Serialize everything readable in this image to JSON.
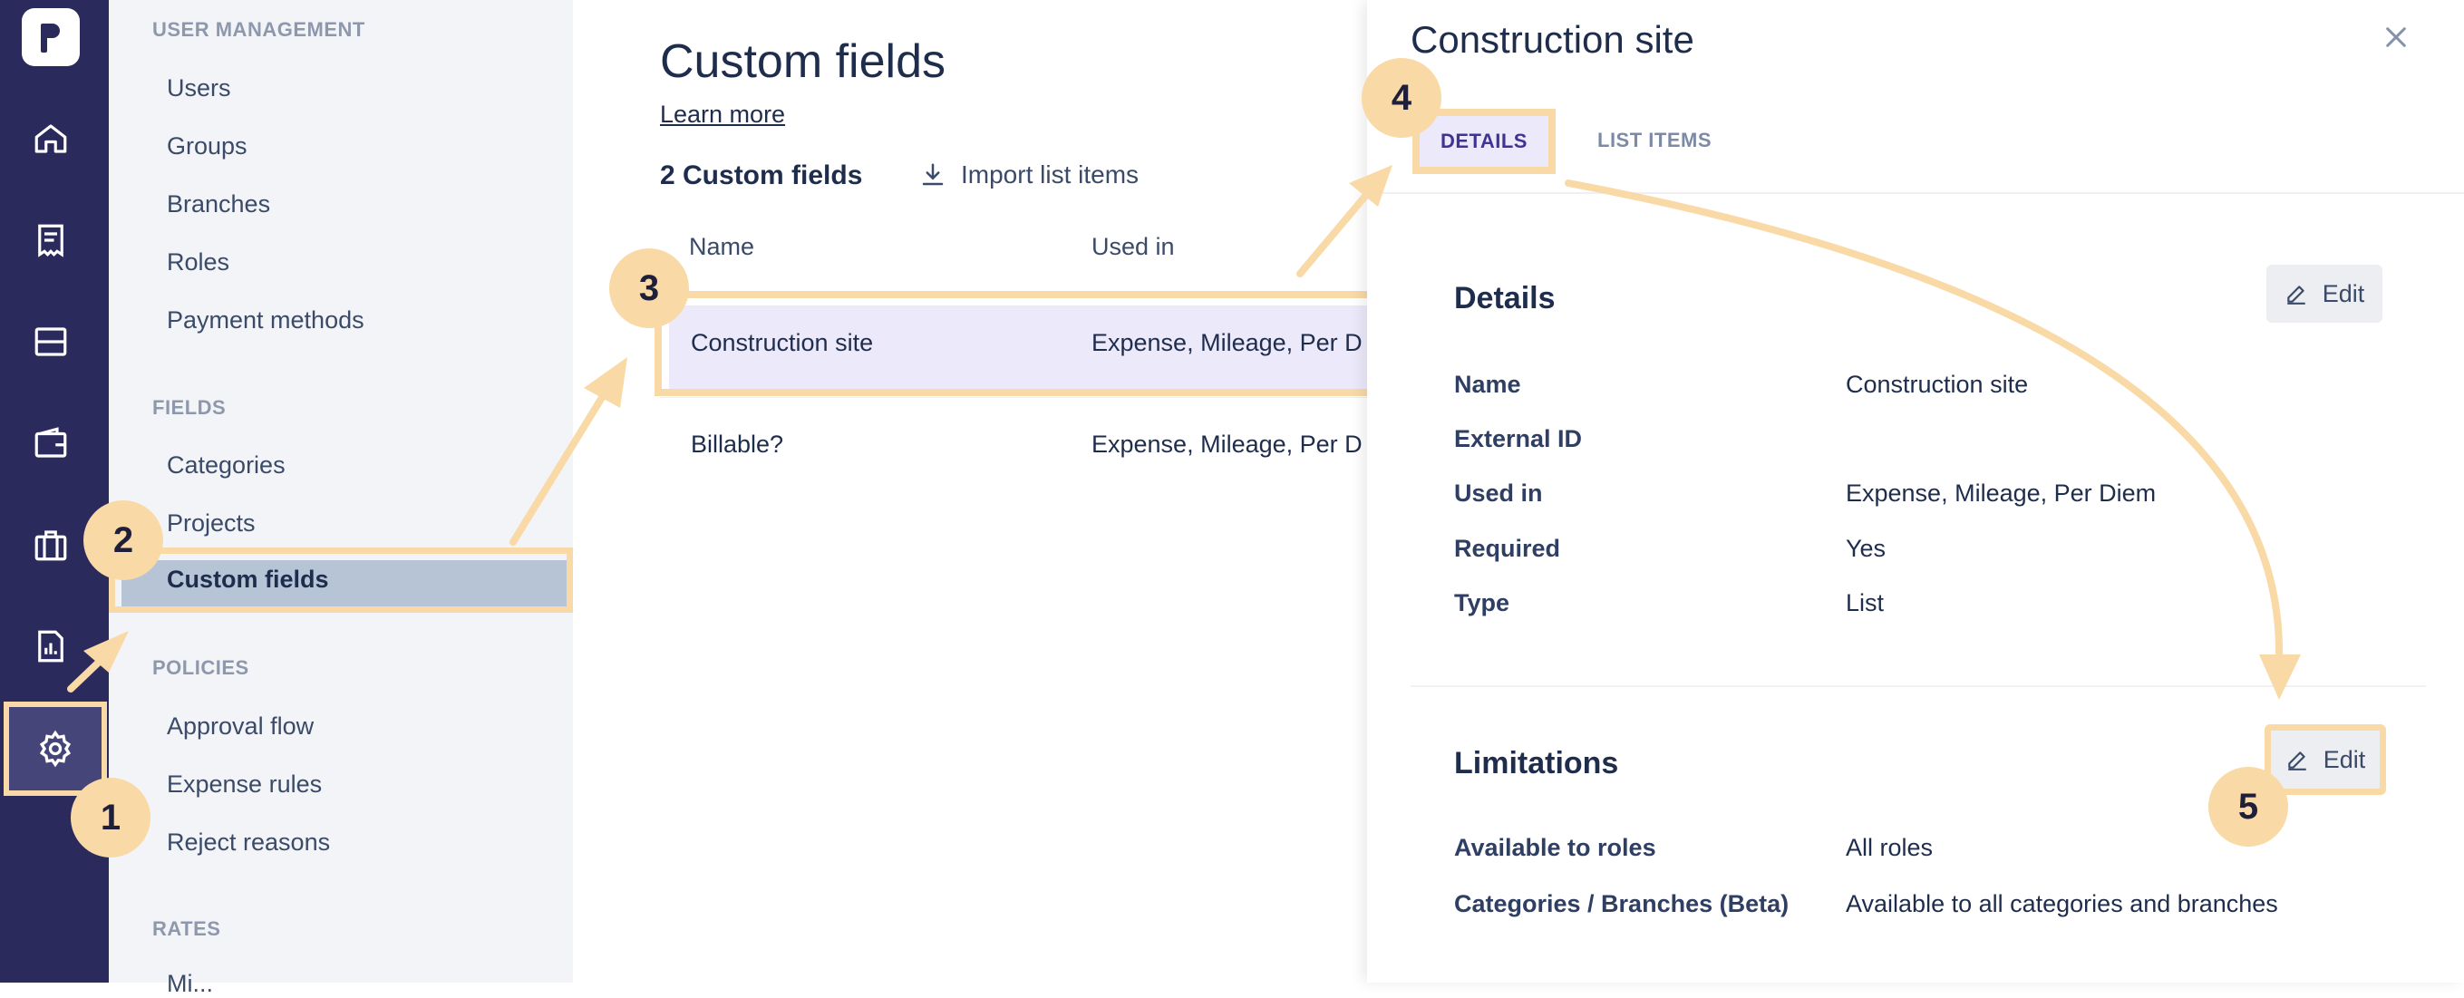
{
  "nav": {
    "sections": {
      "user_management": "USER MANAGEMENT",
      "fields": "FIELDS",
      "policies": "POLICIES",
      "rates": "RATES"
    },
    "user_management_items": [
      "Users",
      "Groups",
      "Branches",
      "Roles",
      "Payment methods"
    ],
    "fields_items": [
      "Categories",
      "Projects",
      "Custom fields"
    ],
    "policies_items": [
      "Approval flow",
      "Expense rules",
      "Reject reasons"
    ],
    "rates_items": [
      "Mi..."
    ]
  },
  "main": {
    "title": "Custom fields",
    "learn_more": "Learn more",
    "count": "2 Custom fields",
    "import_label": "Import list items",
    "columns": {
      "name": "Name",
      "used_in": "Used in"
    },
    "rows": [
      {
        "name": "Construction site",
        "used_in": "Expense, Mileage, Per Diem"
      },
      {
        "name": "Billable?",
        "used_in": "Expense, Mileage, Per Diem"
      }
    ]
  },
  "drawer": {
    "title": "Construction site",
    "tabs": {
      "details": "DETAILS",
      "list_items": "LIST ITEMS"
    },
    "details": {
      "heading": "Details",
      "edit": "Edit",
      "fields": [
        {
          "label": "Name",
          "value": "Construction site"
        },
        {
          "label": "External ID",
          "value": ""
        },
        {
          "label": "Used in",
          "value": "Expense, Mileage, Per Diem"
        },
        {
          "label": "Required",
          "value": "Yes"
        },
        {
          "label": "Type",
          "value": "List"
        }
      ]
    },
    "limitations": {
      "heading": "Limitations",
      "edit": "Edit",
      "fields": [
        {
          "label": "Available to roles",
          "value": "All roles"
        },
        {
          "label": "Categories / Branches (Beta)",
          "value": "Available to all categories and branches"
        }
      ]
    }
  },
  "annotations": {
    "step1": "1",
    "step2": "2",
    "step3": "3",
    "step4": "4",
    "step5": "5"
  },
  "icons": {
    "rail": [
      "home-icon",
      "receipt-icon",
      "card-icon",
      "wallet-icon",
      "briefcase-icon",
      "report-icon",
      "gear-icon"
    ],
    "import": "download-icon",
    "close": "close-icon",
    "edit": "pencil-icon"
  },
  "colors": {
    "rail_bg": "#2b2a5c",
    "highlight": "#f9d9a6",
    "selected_row": "#ece9fb",
    "active_nav": "#b7c4d6",
    "tab_active_text": "#3f3590"
  }
}
